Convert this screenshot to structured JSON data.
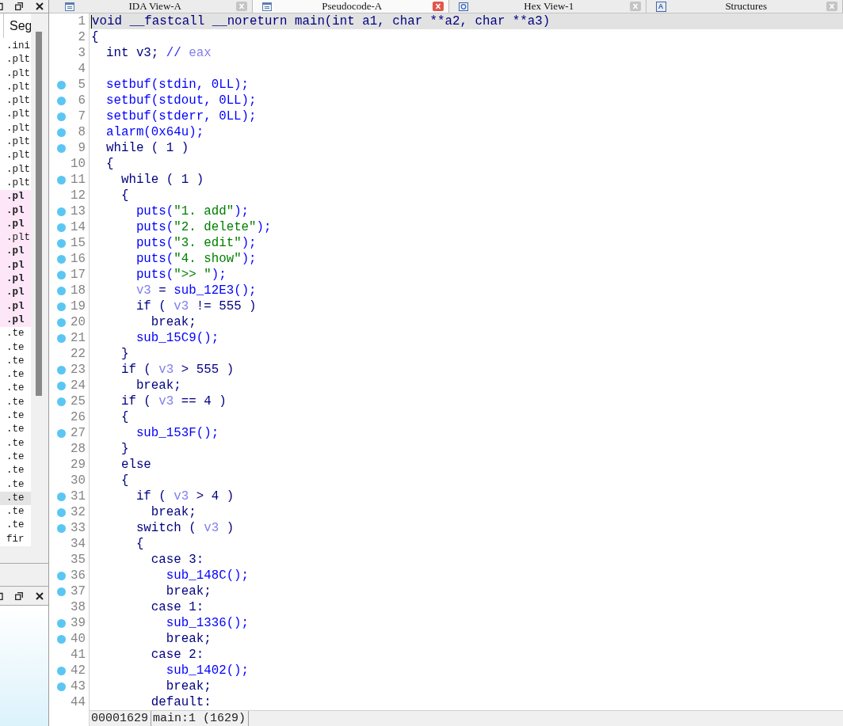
{
  "tabs": [
    {
      "label": "IDA View-A",
      "kind": "listing",
      "selected": false
    },
    {
      "label": "Pseudocode-A",
      "kind": "listing",
      "selected": true
    },
    {
      "label": "Hex View-1",
      "kind": "hex",
      "selected": false
    },
    {
      "label": "Structures",
      "kind": "letter",
      "icon": "A",
      "selected": false
    }
  ],
  "side_panel": {
    "column_header": "Seg",
    "rows": [
      {
        "text": ".ini",
        "highlighted": false,
        "bold": false,
        "selected": false
      },
      {
        "text": ".plt",
        "highlighted": false,
        "bold": false,
        "selected": false
      },
      {
        "text": ".plt",
        "highlighted": false,
        "bold": false,
        "selected": false
      },
      {
        "text": ".plt",
        "highlighted": false,
        "bold": false,
        "selected": false
      },
      {
        "text": ".plt",
        "highlighted": false,
        "bold": false,
        "selected": false
      },
      {
        "text": ".plt",
        "highlighted": false,
        "bold": false,
        "selected": false
      },
      {
        "text": ".plt",
        "highlighted": false,
        "bold": false,
        "selected": false
      },
      {
        "text": ".plt",
        "highlighted": false,
        "bold": false,
        "selected": false
      },
      {
        "text": ".plt",
        "highlighted": false,
        "bold": false,
        "selected": false
      },
      {
        "text": ".plt",
        "highlighted": false,
        "bold": false,
        "selected": false
      },
      {
        "text": ".plt",
        "highlighted": false,
        "bold": false,
        "selected": false
      },
      {
        "text": ".pl",
        "highlighted": true,
        "bold": true,
        "selected": false
      },
      {
        "text": ".pl",
        "highlighted": true,
        "bold": true,
        "selected": false
      },
      {
        "text": ".pl",
        "highlighted": true,
        "bold": true,
        "selected": false
      },
      {
        "text": ".plt",
        "highlighted": true,
        "bold": false,
        "selected": false
      },
      {
        "text": ".pl",
        "highlighted": true,
        "bold": true,
        "selected": false
      },
      {
        "text": ".pl",
        "highlighted": true,
        "bold": true,
        "selected": false
      },
      {
        "text": ".pl",
        "highlighted": true,
        "bold": true,
        "selected": false
      },
      {
        "text": ".pl",
        "highlighted": true,
        "bold": true,
        "selected": false
      },
      {
        "text": ".pl",
        "highlighted": true,
        "bold": true,
        "selected": false
      },
      {
        "text": ".pl",
        "highlighted": true,
        "bold": true,
        "selected": false
      },
      {
        "text": ".te",
        "highlighted": false,
        "bold": false,
        "selected": false
      },
      {
        "text": ".te",
        "highlighted": false,
        "bold": false,
        "selected": false
      },
      {
        "text": ".te",
        "highlighted": false,
        "bold": false,
        "selected": false
      },
      {
        "text": ".te",
        "highlighted": false,
        "bold": false,
        "selected": false
      },
      {
        "text": ".te",
        "highlighted": false,
        "bold": false,
        "selected": false
      },
      {
        "text": ".te",
        "highlighted": false,
        "bold": false,
        "selected": false
      },
      {
        "text": ".te",
        "highlighted": false,
        "bold": false,
        "selected": false
      },
      {
        "text": ".te",
        "highlighted": false,
        "bold": false,
        "selected": false
      },
      {
        "text": ".te",
        "highlighted": false,
        "bold": false,
        "selected": false
      },
      {
        "text": ".te",
        "highlighted": false,
        "bold": false,
        "selected": false
      },
      {
        "text": ".te",
        "highlighted": false,
        "bold": false,
        "selected": false
      },
      {
        "text": ".te",
        "highlighted": false,
        "bold": false,
        "selected": false
      },
      {
        "text": ".te",
        "highlighted": false,
        "bold": false,
        "selected": true
      },
      {
        "text": ".te",
        "highlighted": false,
        "bold": false,
        "selected": false
      },
      {
        "text": ".te",
        "highlighted": false,
        "bold": false,
        "selected": false
      },
      {
        "text": "fir",
        "highlighted": false,
        "bold": false,
        "selected": false
      }
    ]
  },
  "editor": {
    "lines": [
      {
        "number": "1",
        "dot": false,
        "selected": true,
        "tokens": [
          {
            "kind": "plain",
            "text": "void __fastcall __noreturn main(int a1, char **a2, char **a3)"
          }
        ]
      },
      {
        "number": "2",
        "dot": false,
        "selected": false,
        "tokens": [
          {
            "kind": "plain",
            "text": "{"
          }
        ]
      },
      {
        "number": "3",
        "dot": false,
        "selected": false,
        "tokens": [
          {
            "kind": "plain",
            "text": "  int v3; "
          },
          {
            "kind": "comment",
            "text": "//"
          },
          {
            "kind": "var",
            "text": " eax"
          }
        ]
      },
      {
        "number": "4",
        "dot": false,
        "selected": false
      },
      {
        "number": "5",
        "dot": true,
        "selected": false,
        "tokens": [
          {
            "kind": "call",
            "text": "  setbuf(stdin, 0LL);"
          }
        ]
      },
      {
        "number": "6",
        "dot": true,
        "selected": false,
        "tokens": [
          {
            "kind": "call",
            "text": "  setbuf(stdout, 0LL);"
          }
        ]
      },
      {
        "number": "7",
        "dot": true,
        "selected": false,
        "tokens": [
          {
            "kind": "call",
            "text": "  setbuf(stderr, 0LL);"
          }
        ]
      },
      {
        "number": "8",
        "dot": true,
        "selected": false,
        "tokens": [
          {
            "kind": "call",
            "text": "  alarm(0x64u);"
          }
        ]
      },
      {
        "number": "9",
        "dot": true,
        "selected": false,
        "tokens": [
          {
            "kind": "plain",
            "text": "  while ( 1 )"
          }
        ]
      },
      {
        "number": "10",
        "dot": false,
        "selected": false,
        "tokens": [
          {
            "kind": "plain",
            "text": "  {"
          }
        ]
      },
      {
        "number": "11",
        "dot": true,
        "selected": false,
        "tokens": [
          {
            "kind": "plain",
            "text": "    while ( 1 )"
          }
        ]
      },
      {
        "number": "12",
        "dot": false,
        "selected": false,
        "tokens": [
          {
            "kind": "plain",
            "text": "    {"
          }
        ]
      },
      {
        "number": "13",
        "dot": true,
        "selected": false,
        "tokens": [
          {
            "kind": "call",
            "text": "      puts("
          },
          {
            "kind": "string",
            "text": "\"1. add\""
          },
          {
            "kind": "call",
            "text": ");"
          }
        ]
      },
      {
        "number": "14",
        "dot": true,
        "selected": false,
        "tokens": [
          {
            "kind": "call",
            "text": "      puts("
          },
          {
            "kind": "string",
            "text": "\"2. delete\""
          },
          {
            "kind": "call",
            "text": ");"
          }
        ]
      },
      {
        "number": "15",
        "dot": true,
        "selected": false,
        "tokens": [
          {
            "kind": "call",
            "text": "      puts("
          },
          {
            "kind": "string",
            "text": "\"3. edit\""
          },
          {
            "kind": "call",
            "text": ");"
          }
        ]
      },
      {
        "number": "16",
        "dot": true,
        "selected": false,
        "tokens": [
          {
            "kind": "call",
            "text": "      puts("
          },
          {
            "kind": "string",
            "text": "\"4. show\""
          },
          {
            "kind": "call",
            "text": ");"
          }
        ]
      },
      {
        "number": "17",
        "dot": true,
        "selected": false,
        "tokens": [
          {
            "kind": "call",
            "text": "      puts("
          },
          {
            "kind": "string",
            "text": "\">> \""
          },
          {
            "kind": "call",
            "text": ");"
          }
        ]
      },
      {
        "number": "18",
        "dot": true,
        "selected": false,
        "tokens": [
          {
            "kind": "var",
            "text": "      v3"
          },
          {
            "kind": "plain",
            "text": " = "
          },
          {
            "kind": "call",
            "text": "sub_12E3();"
          }
        ]
      },
      {
        "number": "19",
        "dot": true,
        "selected": false,
        "tokens": [
          {
            "kind": "plain",
            "text": "      if ( "
          },
          {
            "kind": "var",
            "text": "v3"
          },
          {
            "kind": "plain",
            "text": " != 555 )"
          }
        ]
      },
      {
        "number": "20",
        "dot": true,
        "selected": false,
        "tokens": [
          {
            "kind": "plain",
            "text": "        break;"
          }
        ]
      },
      {
        "number": "21",
        "dot": true,
        "selected": false,
        "tokens": [
          {
            "kind": "call",
            "text": "      sub_15C9();"
          }
        ]
      },
      {
        "number": "22",
        "dot": false,
        "selected": false,
        "tokens": [
          {
            "kind": "plain",
            "text": "    }"
          }
        ]
      },
      {
        "number": "23",
        "dot": true,
        "selected": false,
        "tokens": [
          {
            "kind": "plain",
            "text": "    if ( "
          },
          {
            "kind": "var",
            "text": "v3"
          },
          {
            "kind": "plain",
            "text": " > 555 )"
          }
        ]
      },
      {
        "number": "24",
        "dot": true,
        "selected": false,
        "tokens": [
          {
            "kind": "plain",
            "text": "      break;"
          }
        ]
      },
      {
        "number": "25",
        "dot": true,
        "selected": false,
        "tokens": [
          {
            "kind": "plain",
            "text": "    if ( "
          },
          {
            "kind": "var",
            "text": "v3"
          },
          {
            "kind": "plain",
            "text": " == 4 )"
          }
        ]
      },
      {
        "number": "26",
        "dot": false,
        "selected": false,
        "tokens": [
          {
            "kind": "plain",
            "text": "    {"
          }
        ]
      },
      {
        "number": "27",
        "dot": true,
        "selected": false,
        "tokens": [
          {
            "kind": "call",
            "text": "      sub_153F();"
          }
        ]
      },
      {
        "number": "28",
        "dot": false,
        "selected": false,
        "tokens": [
          {
            "kind": "plain",
            "text": "    }"
          }
        ]
      },
      {
        "number": "29",
        "dot": false,
        "selected": false,
        "tokens": [
          {
            "kind": "plain",
            "text": "    else"
          }
        ]
      },
      {
        "number": "30",
        "dot": false,
        "selected": false,
        "tokens": [
          {
            "kind": "plain",
            "text": "    {"
          }
        ]
      },
      {
        "number": "31",
        "dot": true,
        "selected": false,
        "tokens": [
          {
            "kind": "plain",
            "text": "      if ( "
          },
          {
            "kind": "var",
            "text": "v3"
          },
          {
            "kind": "plain",
            "text": " > 4 )"
          }
        ]
      },
      {
        "number": "32",
        "dot": true,
        "selected": false,
        "tokens": [
          {
            "kind": "plain",
            "text": "        break;"
          }
        ]
      },
      {
        "number": "33",
        "dot": true,
        "selected": false,
        "tokens": [
          {
            "kind": "plain",
            "text": "      switch ( "
          },
          {
            "kind": "var",
            "text": "v3"
          },
          {
            "kind": "plain",
            "text": " )"
          }
        ]
      },
      {
        "number": "34",
        "dot": false,
        "selected": false,
        "tokens": [
          {
            "kind": "plain",
            "text": "      {"
          }
        ]
      },
      {
        "number": "35",
        "dot": false,
        "selected": false,
        "tokens": [
          {
            "kind": "plain",
            "text": "        case 3:"
          }
        ]
      },
      {
        "number": "36",
        "dot": true,
        "selected": false,
        "tokens": [
          {
            "kind": "call",
            "text": "          sub_148C();"
          }
        ]
      },
      {
        "number": "37",
        "dot": true,
        "selected": false,
        "tokens": [
          {
            "kind": "plain",
            "text": "          break;"
          }
        ]
      },
      {
        "number": "38",
        "dot": false,
        "selected": false,
        "tokens": [
          {
            "kind": "plain",
            "text": "        case 1:"
          }
        ]
      },
      {
        "number": "39",
        "dot": true,
        "selected": false,
        "tokens": [
          {
            "kind": "call",
            "text": "          sub_1336();"
          }
        ]
      },
      {
        "number": "40",
        "dot": true,
        "selected": false,
        "tokens": [
          {
            "kind": "plain",
            "text": "          break;"
          }
        ]
      },
      {
        "number": "41",
        "dot": false,
        "selected": false,
        "tokens": [
          {
            "kind": "plain",
            "text": "        case 2:"
          }
        ]
      },
      {
        "number": "42",
        "dot": true,
        "selected": false,
        "tokens": [
          {
            "kind": "call",
            "text": "          sub_1402();"
          }
        ]
      },
      {
        "number": "43",
        "dot": true,
        "selected": false,
        "tokens": [
          {
            "kind": "plain",
            "text": "          break;"
          }
        ]
      },
      {
        "number": "44",
        "dot": false,
        "selected": false,
        "tokens": [
          {
            "kind": "plain",
            "text": "        default:"
          }
        ]
      }
    ]
  },
  "status_bar": [
    "00001629",
    "main:1 (1629)"
  ]
}
